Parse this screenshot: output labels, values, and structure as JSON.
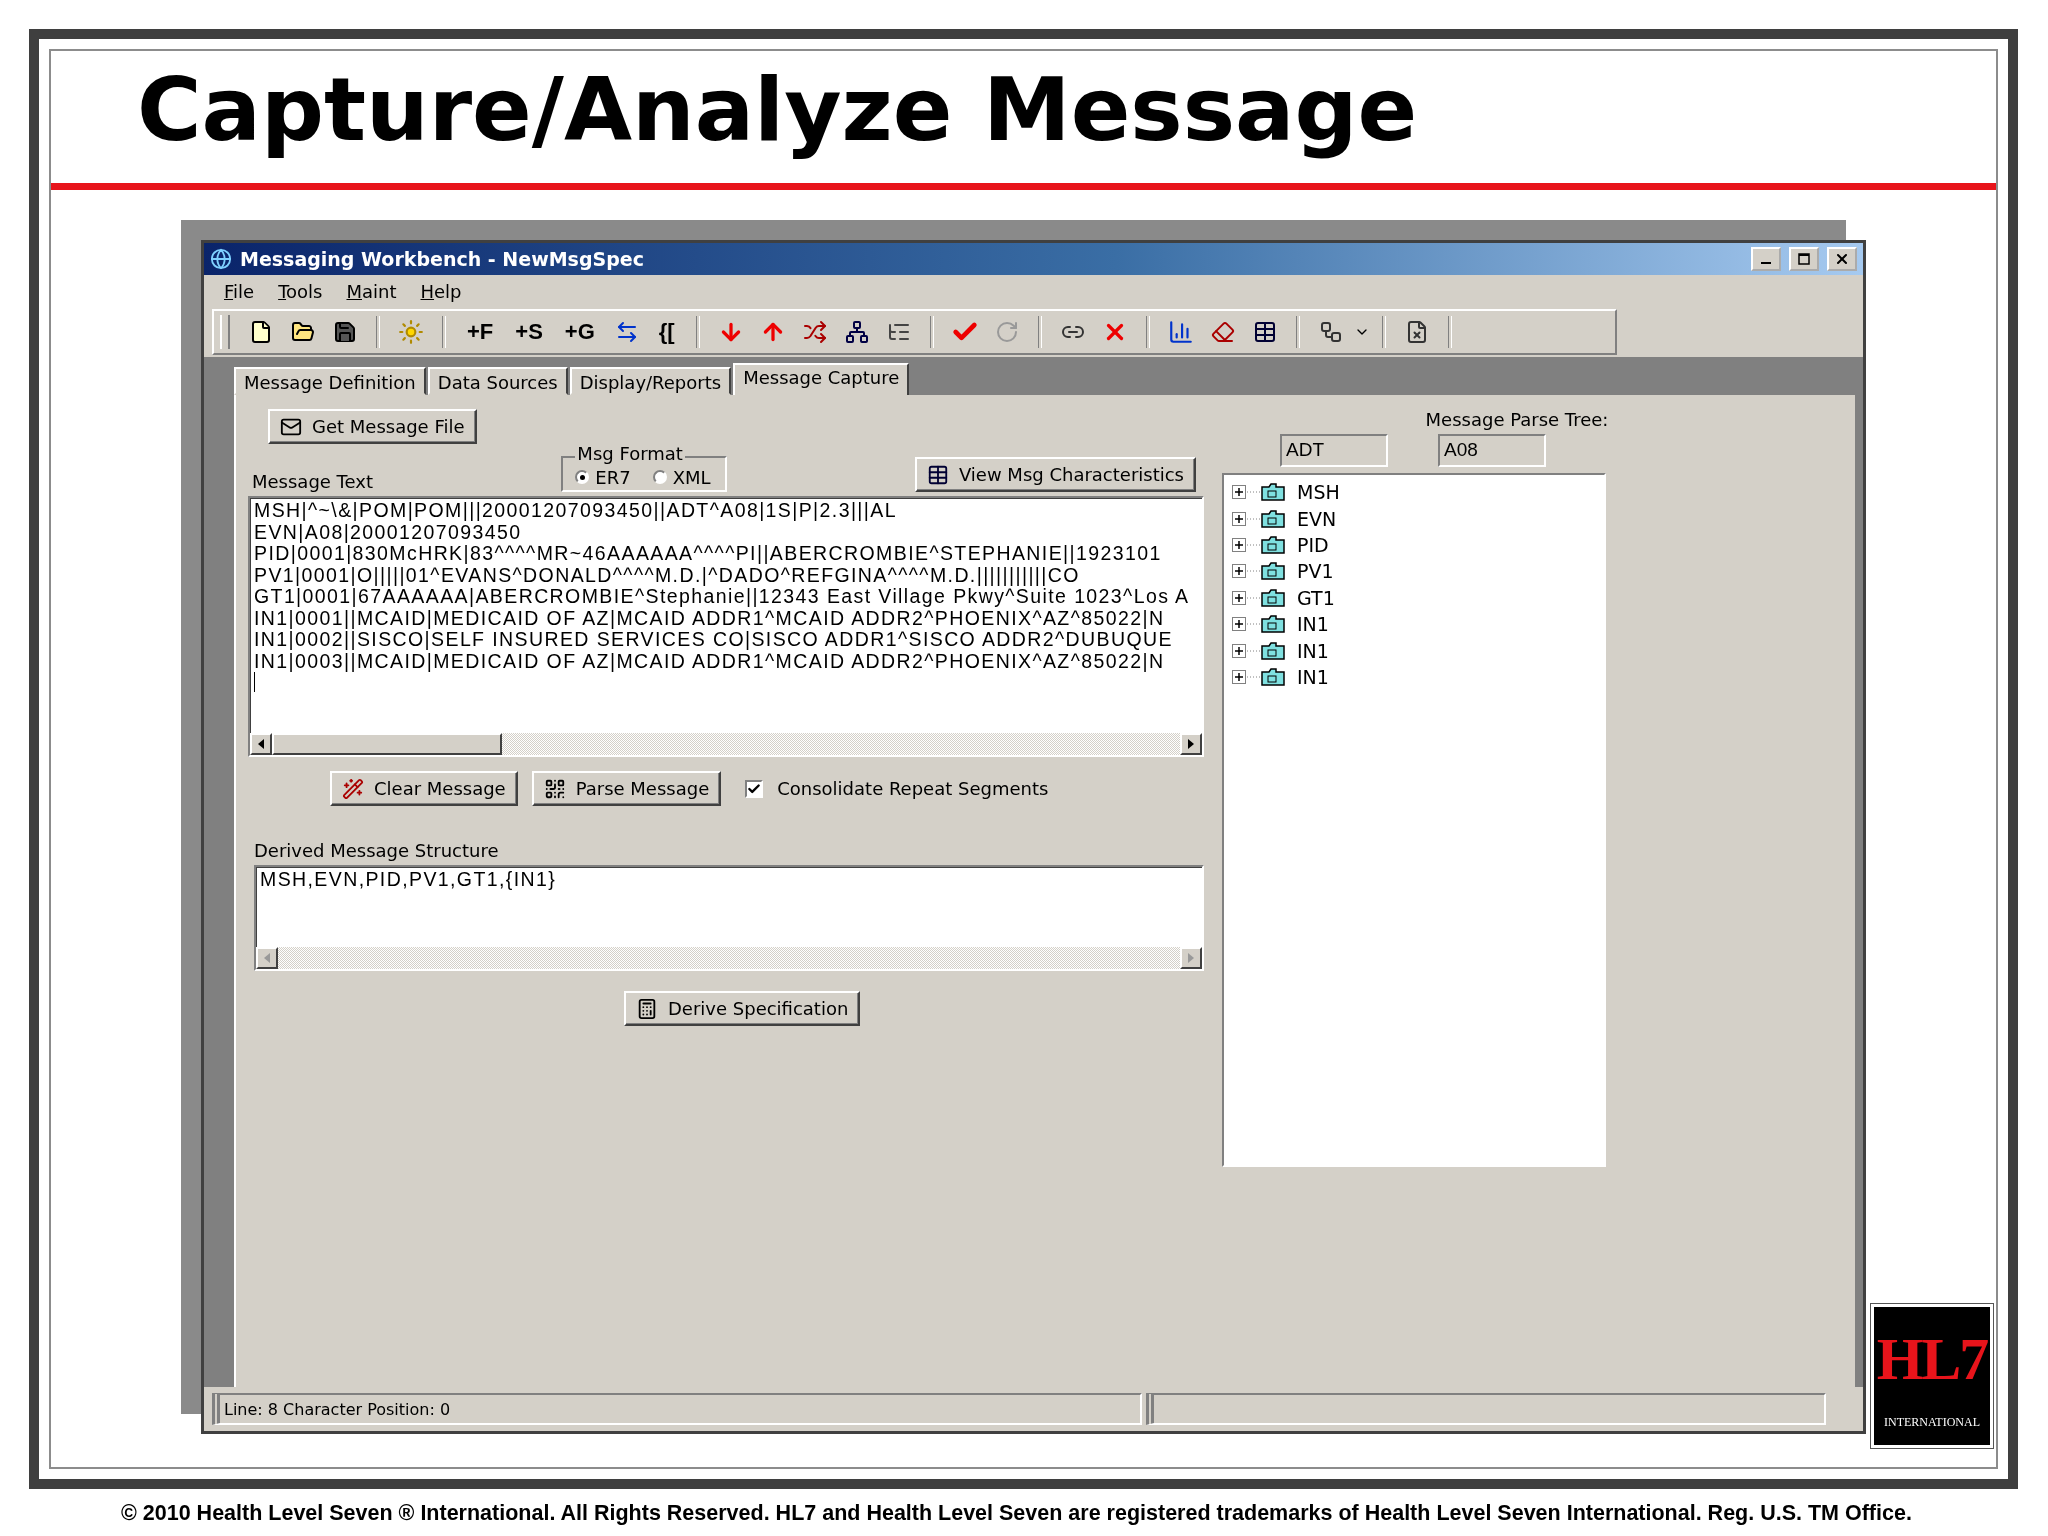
{
  "slide": {
    "title": "Capture/Analyze Message",
    "footer": "© 2010 Health Level Seven ® International. All Rights Reserved. HL7 and Health Level Seven are registered trademarks of Health Level Seven International. Reg. U.S. TM Office."
  },
  "logo": {
    "letters": "HL7",
    "caption": "INTERNATIONAL"
  },
  "window": {
    "title": "Messaging Workbench - NewMsgSpec"
  },
  "menu": [
    "File",
    "Tools",
    "Maint",
    "Help"
  ],
  "toolbar_text": [
    "+F",
    "+S",
    "+G",
    "{["
  ],
  "tabs": [
    {
      "label": "Message Definition",
      "selected": false
    },
    {
      "label": "Data Sources",
      "selected": false
    },
    {
      "label": "Display/Reports",
      "selected": false
    },
    {
      "label": "Message Capture",
      "selected": true
    }
  ],
  "get_message_file": "Get Message File",
  "msg_format": {
    "label": "Msg Format",
    "options": [
      {
        "label": "ER7",
        "selected": true
      },
      {
        "label": "XML",
        "selected": false
      }
    ]
  },
  "view_button": "View Msg Characteristics",
  "message_text": {
    "label": "Message Text",
    "lines": [
      "MSH|^~\\&|POM|POM|||20001207093450||ADT^A08|1S|P|2.3|||AL",
      "EVN|A08|20001207093450",
      "PID|0001|830McHRK|83^^^^MR~46AAAAAA^^^^PI||ABERCROMBIE^STEPHANIE||1923101",
      "PV1|0001|O|||||01^EVANS^DONALD^^^^M.D.|^DADO^REFGINA^^^^M.D.|||||||||||CO",
      "GT1|0001|67AAAAAA|ABERCROMBIE^Stephanie||12343 East Village Pkwy^Suite 1023^Los A",
      "IN1|0001||MCAID|MEDICAID OF AZ|MCAID ADDR1^MCAID ADDR2^PHOENIX^AZ^85022|N",
      "IN1|0002||SISCO|SELF INSURED SERVICES CO|SISCO ADDR1^SISCO ADDR2^DUBUQUE",
      "IN1|0003||MCAID|MEDICAID OF AZ|MCAID ADDR1^MCAID ADDR2^PHOENIX^AZ^85022|N"
    ]
  },
  "clear_button": "Clear Message",
  "parse_button": "Parse Message",
  "consolidate": {
    "label": "Consolidate Repeat Segments",
    "checked": true
  },
  "derived": {
    "label": "Derived Message Structure",
    "value": "MSH,EVN,PID,PV1,GT1,{IN1}"
  },
  "derive_button": "Derive Specification",
  "parse_tree": {
    "label": "Message Parse Tree:",
    "fields": [
      "ADT",
      "A08"
    ],
    "items": [
      {
        "label": "MSH",
        "expanded": false
      },
      {
        "label": "EVN",
        "expanded": false
      },
      {
        "label": "PID",
        "expanded": false
      },
      {
        "label": "PV1",
        "expanded": false
      },
      {
        "label": "GT1",
        "expanded": false
      },
      {
        "label": "IN1",
        "expanded": false
      },
      {
        "label": "IN1",
        "expanded": false
      },
      {
        "label": "IN1",
        "expanded": false
      }
    ]
  },
  "status_bar": {
    "panes": [
      "Line: 8 Character Position: 0"
    ]
  }
}
